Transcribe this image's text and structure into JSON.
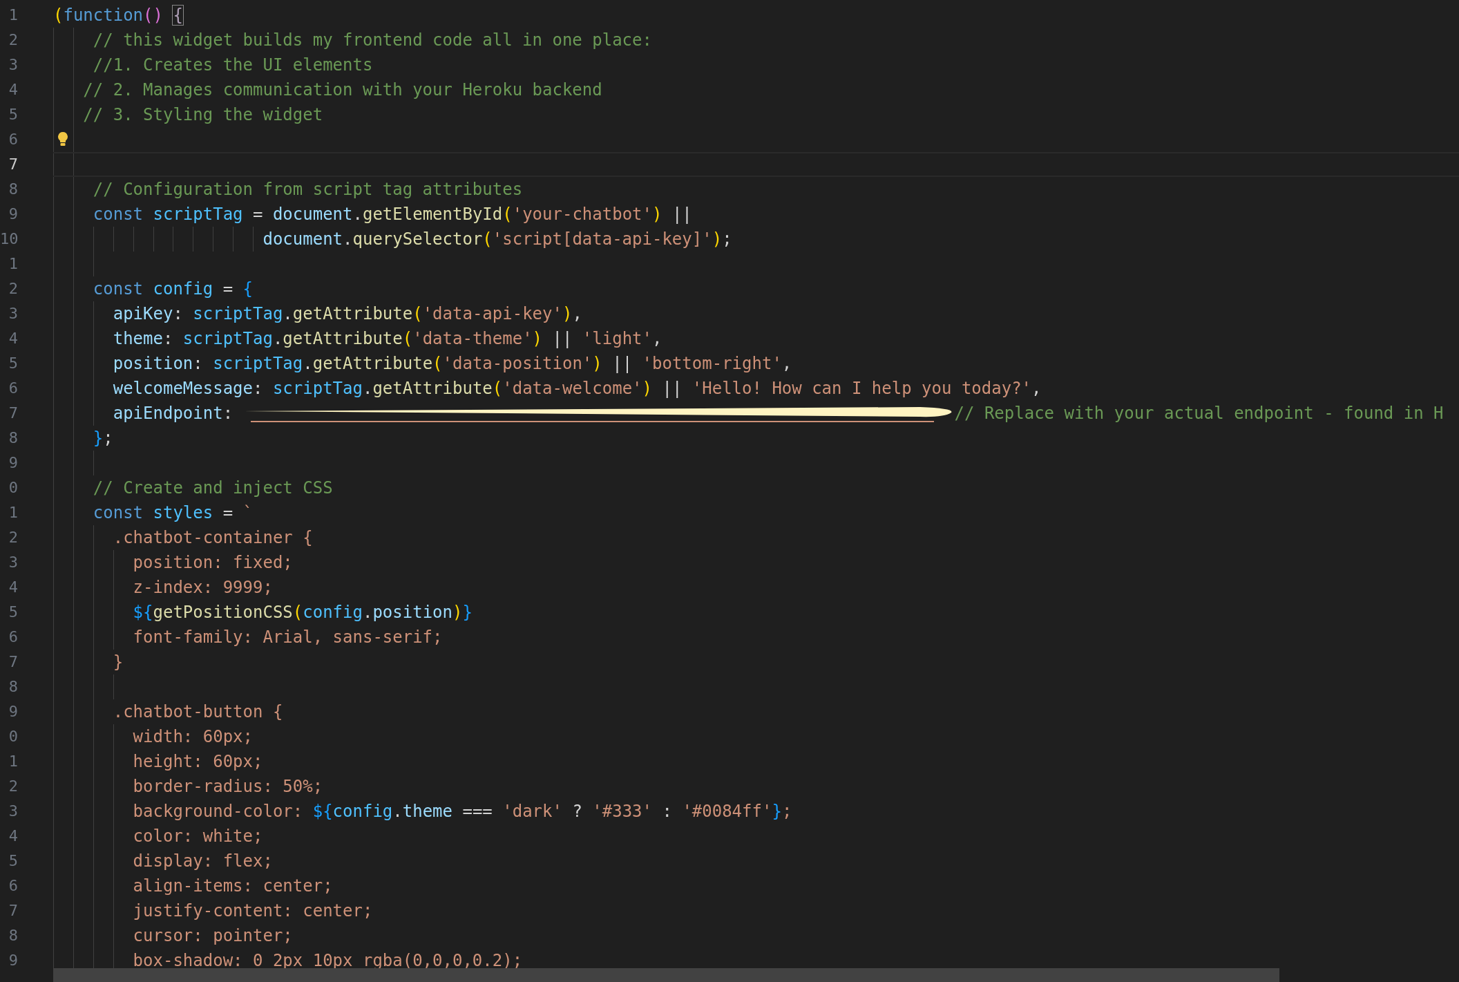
{
  "editor": {
    "lines": [
      {
        "number": "1",
        "selected": false,
        "hint": false,
        "tokens": [
          {
            "kind": "bracket",
            "text": "("
          },
          {
            "kind": "keyword",
            "text": "function"
          },
          {
            "kind": "paren",
            "text": "() "
          },
          {
            "kind": "matched",
            "text": "{"
          }
        ]
      },
      {
        "number": "2",
        "selected": false,
        "hint": false,
        "tokens": [
          {
            "kind": "comment",
            "text": "    // this widget builds my frontend code all in one place:"
          }
        ]
      },
      {
        "number": "3",
        "selected": false,
        "hint": false,
        "tokens": [
          {
            "kind": "comment",
            "text": "    //1. Creates the UI elements"
          }
        ]
      },
      {
        "number": "4",
        "selected": false,
        "hint": false,
        "tokens": [
          {
            "kind": "comment",
            "text": "   // 2. Manages communication with your Heroku backend"
          }
        ]
      },
      {
        "number": "5",
        "selected": false,
        "hint": false,
        "tokens": [
          {
            "kind": "comment",
            "text": "   // 3. Styling the widget"
          }
        ]
      },
      {
        "number": "6",
        "selected": false,
        "hint": true
      },
      {
        "number": "7",
        "selected": true,
        "hint": false
      },
      {
        "number": "8",
        "selected": false,
        "hint": false,
        "tokens": [
          {
            "kind": "comment",
            "text": "    // Configuration from script tag attributes"
          }
        ]
      },
      {
        "number": "9",
        "selected": false,
        "hint": false,
        "tokens": [
          {
            "kind": "keyword",
            "text": "    const "
          },
          {
            "kind": "variable",
            "text": "scriptTag"
          },
          {
            "kind": "plain",
            "text": " = "
          },
          {
            "kind": "property",
            "text": "document"
          },
          {
            "kind": "plain",
            "text": "."
          },
          {
            "kind": "function",
            "text": "getElementById"
          },
          {
            "kind": "bracket",
            "text": "("
          },
          {
            "kind": "string",
            "text": "'your-chatbot'"
          },
          {
            "kind": "bracket",
            "text": ")"
          },
          {
            "kind": "plain",
            "text": " ||"
          }
        ]
      },
      {
        "number": "10",
        "selected": false,
        "hint": false,
        "tokens": [
          {
            "kind": "property",
            "text": "                     document"
          },
          {
            "kind": "plain",
            "text": "."
          },
          {
            "kind": "function",
            "text": "querySelector"
          },
          {
            "kind": "bracket",
            "text": "("
          },
          {
            "kind": "string",
            "text": "'script[data-api-key]'"
          },
          {
            "kind": "bracket",
            "text": ")"
          },
          {
            "kind": "plain",
            "text": ";"
          }
        ]
      },
      {
        "number": "1",
        "selected": false,
        "hint": false
      },
      {
        "number": "2",
        "selected": false,
        "hint": false,
        "tokens": [
          {
            "kind": "keyword",
            "text": "    const "
          },
          {
            "kind": "variable",
            "text": "config"
          },
          {
            "kind": "plain",
            "text": " = "
          },
          {
            "kind": "brace",
            "text": "{"
          }
        ]
      },
      {
        "number": "3",
        "selected": false,
        "hint": false,
        "tokens": [
          {
            "kind": "property",
            "text": "      apiKey"
          },
          {
            "kind": "plain",
            "text": ": "
          },
          {
            "kind": "variable",
            "text": "scriptTag"
          },
          {
            "kind": "plain",
            "text": "."
          },
          {
            "kind": "function",
            "text": "getAttribute"
          },
          {
            "kind": "bracket",
            "text": "("
          },
          {
            "kind": "string",
            "text": "'data-api-key'"
          },
          {
            "kind": "bracket",
            "text": ")"
          },
          {
            "kind": "plain",
            "text": ","
          }
        ]
      },
      {
        "number": "4",
        "selected": false,
        "hint": false,
        "tokens": [
          {
            "kind": "property",
            "text": "      theme"
          },
          {
            "kind": "plain",
            "text": ": "
          },
          {
            "kind": "variable",
            "text": "scriptTag"
          },
          {
            "kind": "plain",
            "text": "."
          },
          {
            "kind": "function",
            "text": "getAttribute"
          },
          {
            "kind": "bracket",
            "text": "("
          },
          {
            "kind": "string",
            "text": "'data-theme'"
          },
          {
            "kind": "bracket",
            "text": ")"
          },
          {
            "kind": "plain",
            "text": " || "
          },
          {
            "kind": "string",
            "text": "'light'"
          },
          {
            "kind": "plain",
            "text": ","
          }
        ]
      },
      {
        "number": "5",
        "selected": false,
        "hint": false,
        "tokens": [
          {
            "kind": "property",
            "text": "      position"
          },
          {
            "kind": "plain",
            "text": ": "
          },
          {
            "kind": "variable",
            "text": "scriptTag"
          },
          {
            "kind": "plain",
            "text": "."
          },
          {
            "kind": "function",
            "text": "getAttribute"
          },
          {
            "kind": "bracket",
            "text": "("
          },
          {
            "kind": "string",
            "text": "'data-position'"
          },
          {
            "kind": "bracket",
            "text": ")"
          },
          {
            "kind": "plain",
            "text": " || "
          },
          {
            "kind": "string",
            "text": "'bottom-right'"
          },
          {
            "kind": "plain",
            "text": ","
          }
        ]
      },
      {
        "number": "6",
        "selected": false,
        "hint": false,
        "tokens": [
          {
            "kind": "property",
            "text": "      welcomeMessage"
          },
          {
            "kind": "plain",
            "text": ": "
          },
          {
            "kind": "variable",
            "text": "scriptTag"
          },
          {
            "kind": "plain",
            "text": "."
          },
          {
            "kind": "function",
            "text": "getAttribute"
          },
          {
            "kind": "bracket",
            "text": "("
          },
          {
            "kind": "string",
            "text": "'data-welcome'"
          },
          {
            "kind": "bracket",
            "text": ")"
          },
          {
            "kind": "plain",
            "text": " || "
          },
          {
            "kind": "string",
            "text": "'Hello! How can I help you today?'"
          },
          {
            "kind": "plain",
            "text": ","
          }
        ]
      },
      {
        "number": "7",
        "selected": false,
        "hint": false,
        "tokens": [
          {
            "kind": "property",
            "text": "      apiEndpoint"
          },
          {
            "kind": "plain",
            "text": ": "
          },
          {
            "kind": "redacted"
          },
          {
            "kind": "comment",
            "text": "// Replace with your actual endpoint - found in H"
          }
        ]
      },
      {
        "number": "8",
        "selected": false,
        "hint": false,
        "tokens": [
          {
            "kind": "brace",
            "text": "    }"
          },
          {
            "kind": "plain",
            "text": ";"
          }
        ]
      },
      {
        "number": "9",
        "selected": false,
        "hint": false
      },
      {
        "number": "0",
        "selected": false,
        "hint": false,
        "tokens": [
          {
            "kind": "comment",
            "text": "    // Create and inject CSS"
          }
        ]
      },
      {
        "number": "1",
        "selected": false,
        "hint": false,
        "tokens": [
          {
            "kind": "keyword",
            "text": "    const "
          },
          {
            "kind": "variable",
            "text": "styles"
          },
          {
            "kind": "plain",
            "text": " = "
          },
          {
            "kind": "string",
            "text": "`"
          }
        ]
      },
      {
        "number": "2",
        "selected": false,
        "hint": false,
        "tokens": [
          {
            "kind": "string",
            "text": "      .chatbot-container {"
          }
        ]
      },
      {
        "number": "3",
        "selected": false,
        "hint": false,
        "tokens": [
          {
            "kind": "string",
            "text": "        position: fixed;"
          }
        ]
      },
      {
        "number": "4",
        "selected": false,
        "hint": false,
        "tokens": [
          {
            "kind": "string",
            "text": "        z-index: 9999;"
          }
        ]
      },
      {
        "number": "5",
        "selected": false,
        "hint": false,
        "tokens": [
          {
            "kind": "brace",
            "text": "        ${"
          },
          {
            "kind": "function",
            "text": "getPositionCSS"
          },
          {
            "kind": "bracket",
            "text": "("
          },
          {
            "kind": "variable",
            "text": "config"
          },
          {
            "kind": "plain",
            "text": "."
          },
          {
            "kind": "property",
            "text": "position"
          },
          {
            "kind": "bracket",
            "text": ")"
          },
          {
            "kind": "brace",
            "text": "}"
          }
        ]
      },
      {
        "number": "6",
        "selected": false,
        "hint": false,
        "tokens": [
          {
            "kind": "string",
            "text": "        font-family: Arial, sans-serif;"
          }
        ]
      },
      {
        "number": "7",
        "selected": false,
        "hint": false,
        "tokens": [
          {
            "kind": "string",
            "text": "      }"
          }
        ]
      },
      {
        "number": "8",
        "selected": false,
        "hint": false
      },
      {
        "number": "9",
        "selected": false,
        "hint": false,
        "tokens": [
          {
            "kind": "string",
            "text": "      .chatbot-button {"
          }
        ]
      },
      {
        "number": "0",
        "selected": false,
        "hint": false,
        "tokens": [
          {
            "kind": "string",
            "text": "        width: 60px;"
          }
        ]
      },
      {
        "number": "1",
        "selected": false,
        "hint": false,
        "tokens": [
          {
            "kind": "string",
            "text": "        height: 60px;"
          }
        ]
      },
      {
        "number": "2",
        "selected": false,
        "hint": false,
        "tokens": [
          {
            "kind": "string",
            "text": "        border-radius: 50%;"
          }
        ]
      },
      {
        "number": "3",
        "selected": false,
        "hint": false,
        "tokens": [
          {
            "kind": "string",
            "text": "        background-color: "
          },
          {
            "kind": "brace",
            "text": "${"
          },
          {
            "kind": "variable",
            "text": "config"
          },
          {
            "kind": "plain",
            "text": "."
          },
          {
            "kind": "property",
            "text": "theme"
          },
          {
            "kind": "plain",
            "text": " === "
          },
          {
            "kind": "string",
            "text": "'dark'"
          },
          {
            "kind": "plain",
            "text": " ? "
          },
          {
            "kind": "string",
            "text": "'#333'"
          },
          {
            "kind": "plain",
            "text": " : "
          },
          {
            "kind": "string",
            "text": "'#0084ff'"
          },
          {
            "kind": "brace",
            "text": "}"
          },
          {
            "kind": "string",
            "text": ";"
          }
        ]
      },
      {
        "number": "4",
        "selected": false,
        "hint": false,
        "tokens": [
          {
            "kind": "string",
            "text": "        color: white;"
          }
        ]
      },
      {
        "number": "5",
        "selected": false,
        "hint": false,
        "tokens": [
          {
            "kind": "string",
            "text": "        display: flex;"
          }
        ]
      },
      {
        "number": "6",
        "selected": false,
        "hint": false,
        "tokens": [
          {
            "kind": "string",
            "text": "        align-items: center;"
          }
        ]
      },
      {
        "number": "7",
        "selected": false,
        "hint": false,
        "tokens": [
          {
            "kind": "string",
            "text": "        justify-content: center;"
          }
        ]
      },
      {
        "number": "8",
        "selected": false,
        "hint": false,
        "tokens": [
          {
            "kind": "string",
            "text": "        cursor: pointer;"
          }
        ]
      },
      {
        "number": "9",
        "selected": false,
        "hint": false,
        "tokens": [
          {
            "kind": "string",
            "text": "        box-shadow: 0 2px 10px rgba(0,0,0,0.2);"
          }
        ]
      }
    ]
  }
}
